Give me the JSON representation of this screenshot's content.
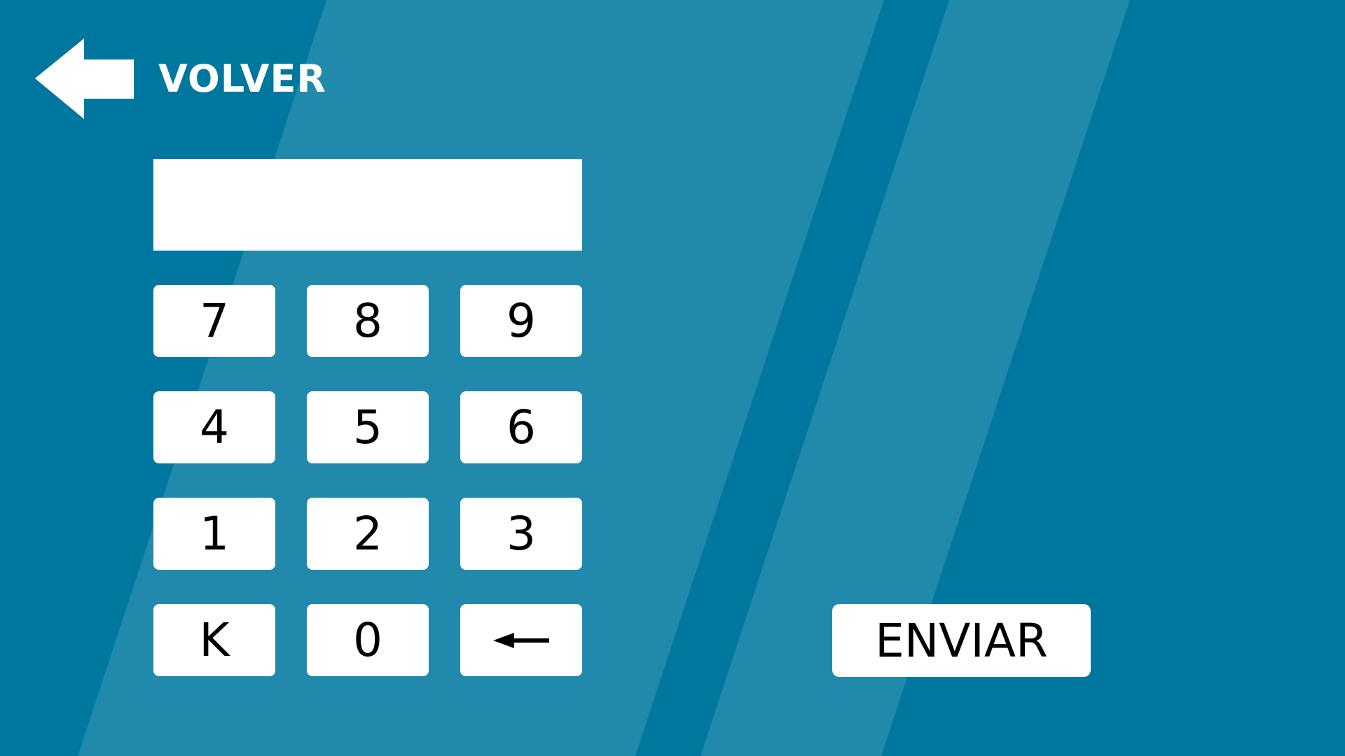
{
  "colors": {
    "background": "#00779e",
    "stripe": "#2189ab",
    "button_background": "#ffffff",
    "button_text": "#000000",
    "header_text": "#ffffff"
  },
  "header": {
    "back_icon": "arrow-left-icon",
    "back_label": "VOLVER"
  },
  "display": {
    "value": ""
  },
  "keypad": {
    "keys": [
      {
        "label": "7"
      },
      {
        "label": "8"
      },
      {
        "label": "9"
      },
      {
        "label": "4"
      },
      {
        "label": "5"
      },
      {
        "label": "6"
      },
      {
        "label": "1"
      },
      {
        "label": "2"
      },
      {
        "label": "3"
      },
      {
        "label": "K"
      },
      {
        "label": "0"
      },
      {
        "icon": "backspace-arrow-icon"
      }
    ]
  },
  "actions": {
    "submit_label": "ENVIAR"
  }
}
